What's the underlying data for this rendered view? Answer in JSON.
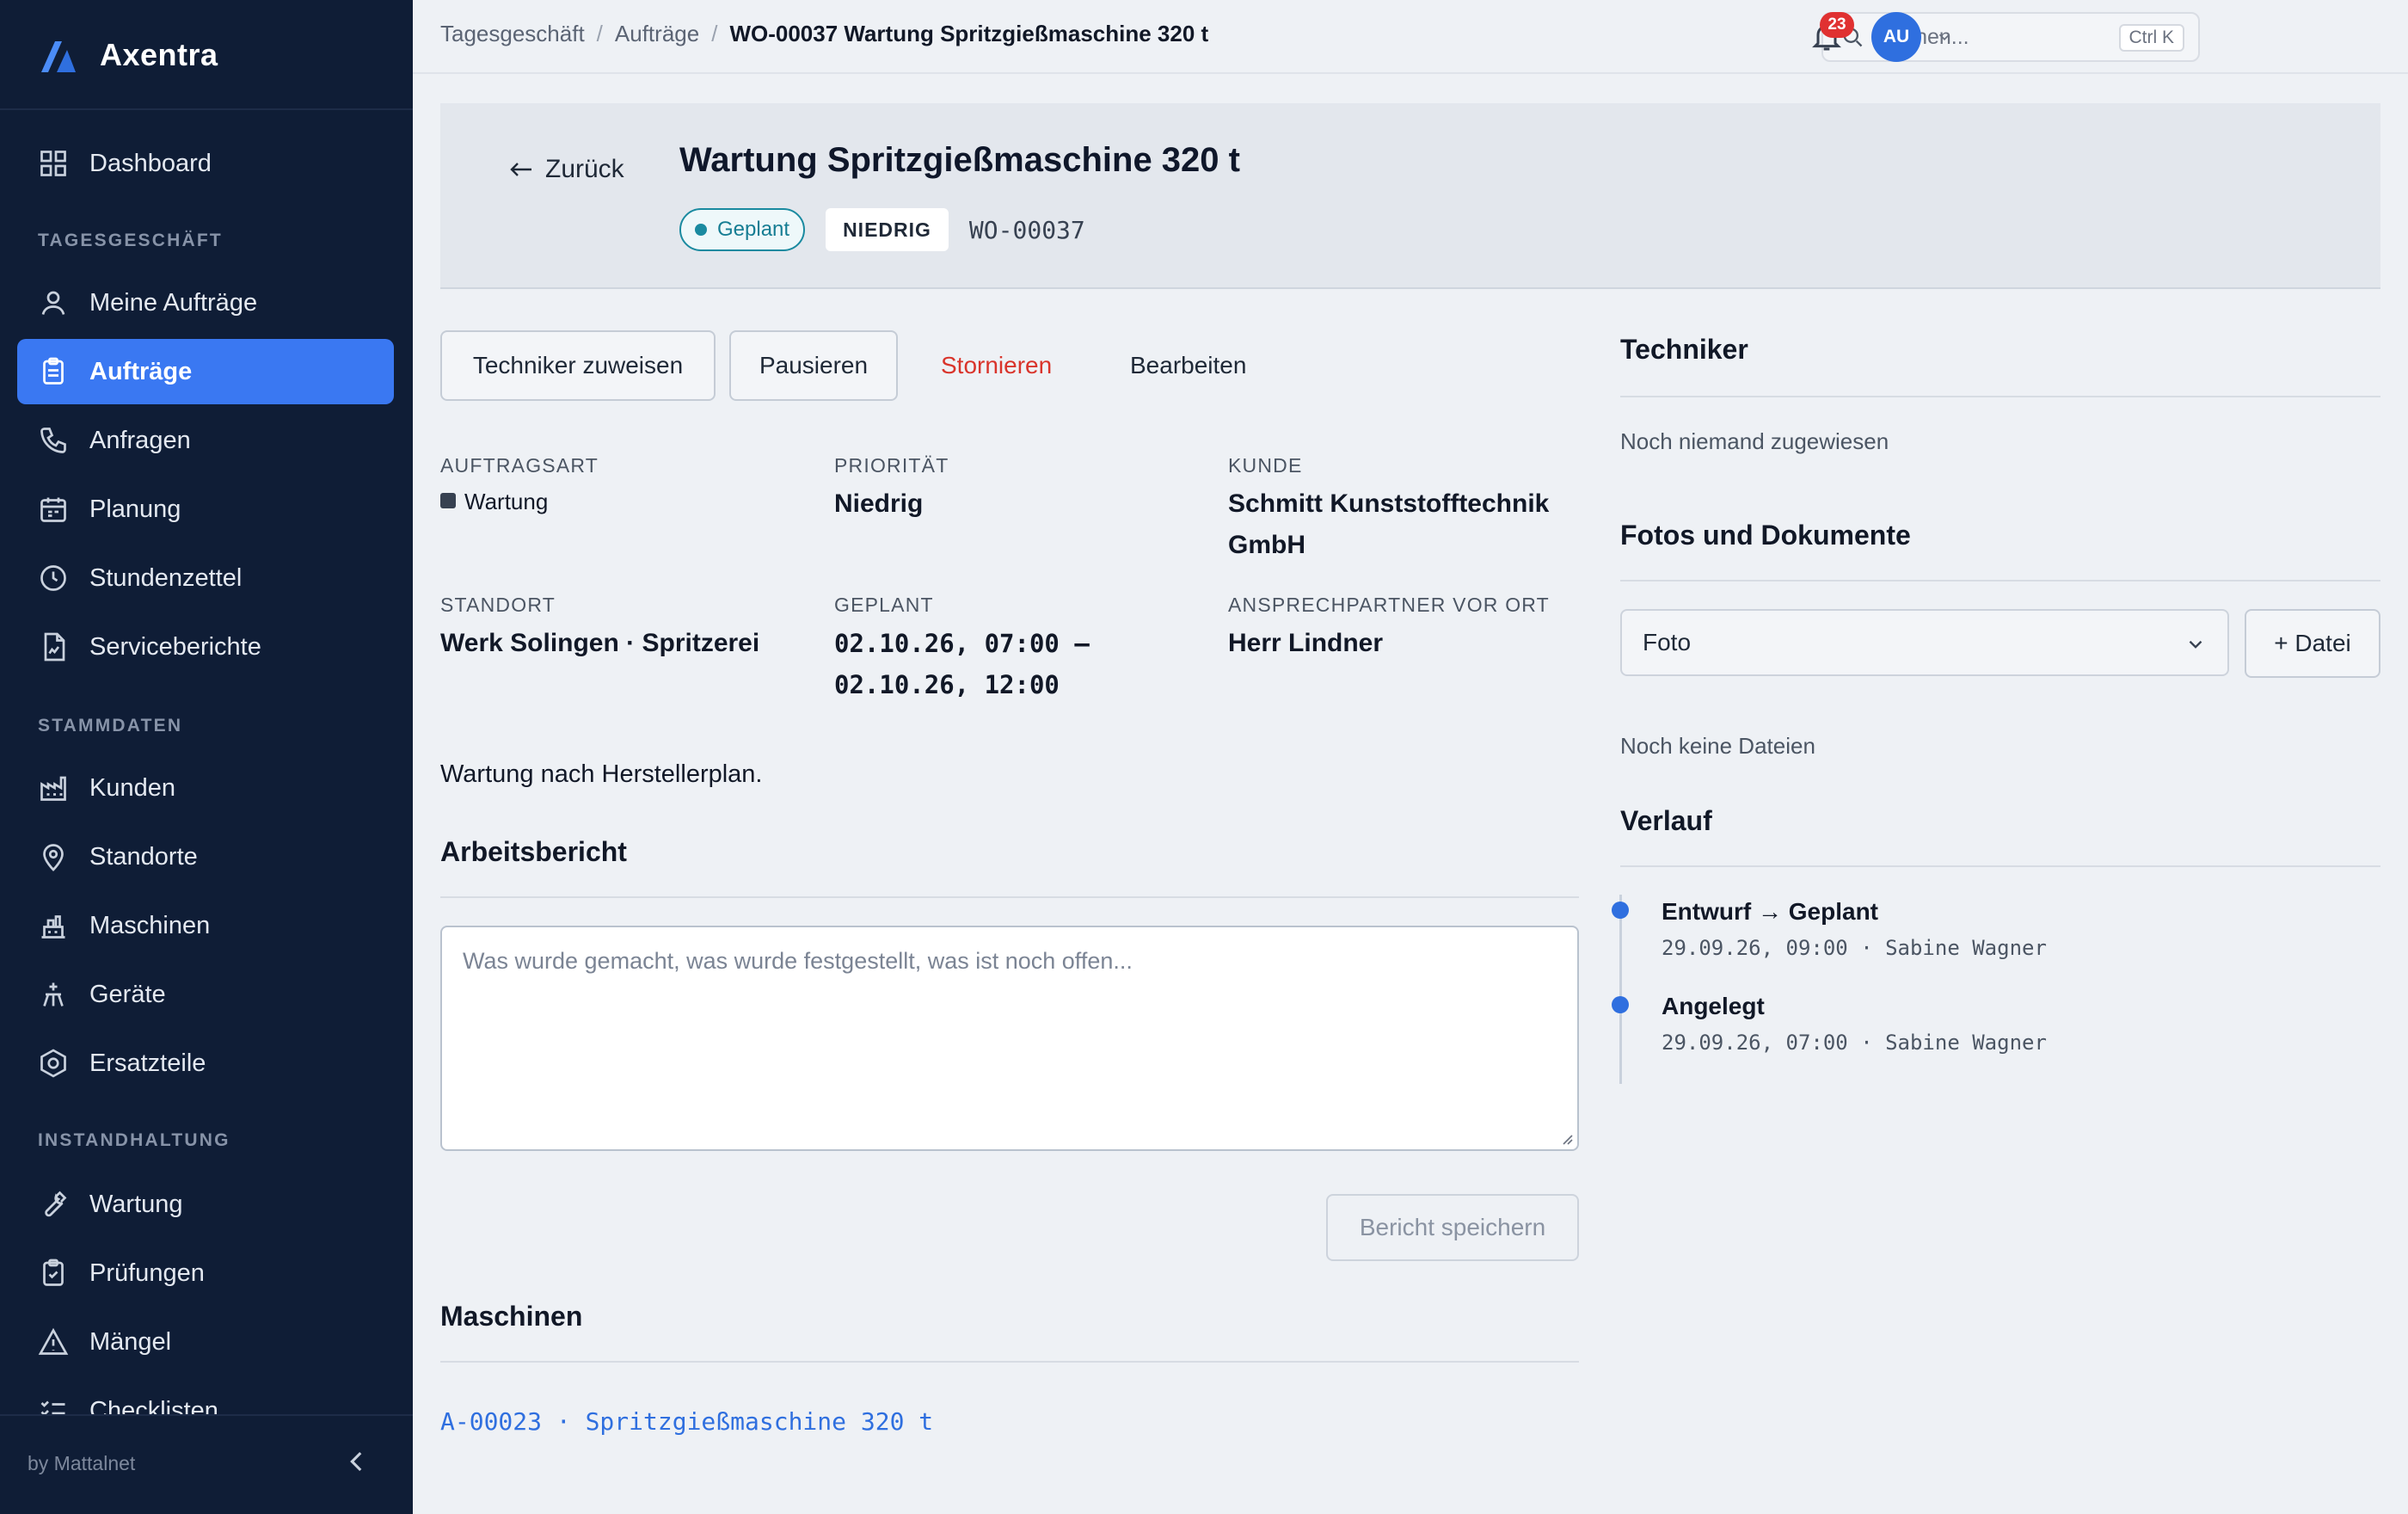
{
  "app": {
    "name": "Axentra",
    "footer": "by Mattalnet"
  },
  "sidebar": {
    "top_item": {
      "label": "Dashboard",
      "icon": "grid-icon"
    },
    "sections": [
      {
        "title": "TAGESGESCHÄFT",
        "items": [
          {
            "label": "Meine Aufträge",
            "icon": "user-icon"
          },
          {
            "label": "Aufträge",
            "icon": "clipboard-icon",
            "active": true
          },
          {
            "label": "Anfragen",
            "icon": "phone-icon"
          },
          {
            "label": "Planung",
            "icon": "calendar-icon"
          },
          {
            "label": "Stundenzettel",
            "icon": "clock-icon"
          },
          {
            "label": "Serviceberichte",
            "icon": "file-chart-icon"
          }
        ]
      },
      {
        "title": "STAMMDATEN",
        "items": [
          {
            "label": "Kunden",
            "icon": "factory-icon"
          },
          {
            "label": "Standorte",
            "icon": "map-pin-icon"
          },
          {
            "label": "Maschinen",
            "icon": "machine-icon"
          },
          {
            "label": "Geräte",
            "icon": "device-icon"
          },
          {
            "label": "Ersatzteile",
            "icon": "hex-bolt-icon"
          }
        ]
      },
      {
        "title": "INSTANDHALTUNG",
        "items": [
          {
            "label": "Wartung",
            "icon": "wrench-icon"
          },
          {
            "label": "Prüfungen",
            "icon": "clipboard-check-icon"
          },
          {
            "label": "Mängel",
            "icon": "warning-icon"
          },
          {
            "label": "Checklisten",
            "icon": "checklist-icon"
          }
        ]
      }
    ]
  },
  "topbar": {
    "breadcrumb": [
      "Tagesgeschäft",
      "Aufträge",
      "WO-00037 Wartung Spritzgießmaschine 320 t"
    ],
    "search_placeholder": "Suchen...",
    "search_shortcut": "Ctrl K",
    "notification_count": "23",
    "avatar_initials": "AU"
  },
  "header": {
    "back_label": "Zurück",
    "title": "Wartung Spritzgießmaschine 320 t",
    "status": "Geplant",
    "priority_badge": "NIEDRIG",
    "wo_number": "WO-00037"
  },
  "actions": {
    "assign": "Techniker zuweisen",
    "pause": "Pausieren",
    "cancel": "Stornieren",
    "edit": "Bearbeiten"
  },
  "fields": {
    "auftragsart": {
      "label": "AUFTRAGSART",
      "value": "Wartung"
    },
    "prioritaet": {
      "label": "PRIORITÄT",
      "value": "Niedrig"
    },
    "kunde": {
      "label": "KUNDE",
      "value": "Schmitt Kunststofftechnik GmbH"
    },
    "standort": {
      "label": "STANDORT",
      "value": "Werk Solingen · Spritzerei"
    },
    "geplant": {
      "label": "GEPLANT",
      "value": "02.10.26, 07:00 – 02.10.26, 12:00"
    },
    "ansprechpartner": {
      "label": "ANSPRECHPARTNER VOR ORT",
      "value": "Herr Lindner"
    }
  },
  "description": "Wartung nach Herstellerplan.",
  "report": {
    "title": "Arbeitsbericht",
    "placeholder": "Was wurde gemacht, was wurde festgestellt, was ist noch offen...",
    "save_label": "Bericht speichern"
  },
  "machines": {
    "title": "Maschinen",
    "items": [
      "A-00023 · Spritzgießmaschine 320 t"
    ]
  },
  "technician": {
    "title": "Techniker",
    "empty": "Noch niemand zugewiesen"
  },
  "files": {
    "title": "Fotos und Dokumente",
    "type_selected": "Foto",
    "add_label": "+ Datei",
    "empty": "Noch keine Dateien"
  },
  "history": {
    "title": "Verlauf",
    "entries": [
      {
        "title": "Entwurf → Geplant",
        "meta": "29.09.26, 09:00 · Sabine Wagner"
      },
      {
        "title": "Angelegt",
        "meta": "29.09.26, 07:00 · Sabine Wagner"
      }
    ]
  },
  "colors": {
    "sidebar_bg": "#0f1d36",
    "accent": "#3a78f2",
    "status_teal": "#1a8aa0",
    "danger": "#d9342b",
    "link": "#2f6fdf"
  }
}
